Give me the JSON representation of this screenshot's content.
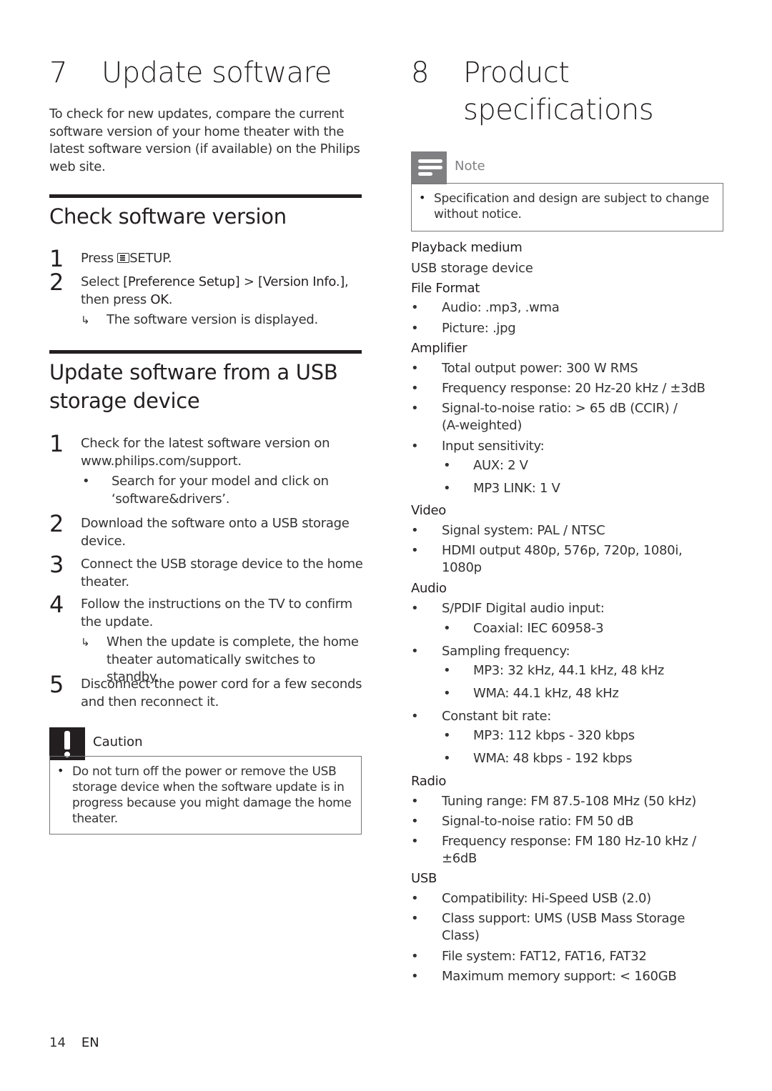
{
  "left": {
    "chapter_number": "7",
    "chapter_title": "Update software",
    "intro": "To check for new updates, compare the current software version of your home theater with the latest software version (if available) on the Philips web site.",
    "section1": {
      "title": "Check software version",
      "steps": [
        {
          "n": "1",
          "pre": "Press ",
          "icon": "setup-icon",
          "post": "SETUP."
        },
        {
          "n": "2",
          "text_a": "Select ",
          "bold_a": "[Preference Setup]",
          "text_b": " > ",
          "bold_b": "[Version Info.]",
          "text_c": ", then press ",
          "bold_c": "OK",
          "text_d": "."
        }
      ],
      "result": "The software version is displayed."
    },
    "section2": {
      "title_line1": "Update software from a USB",
      "title_line2": "storage device",
      "steps": [
        {
          "n": "1",
          "text": "Check for the latest software version on www.philips.com/support."
        },
        {
          "n": "2",
          "text": "Download the software onto a USB storage device."
        },
        {
          "n": "3",
          "text": "Connect the USB storage device to the home theater."
        },
        {
          "n": "4",
          "text": "Follow the instructions on the TV to confirm the update."
        },
        {
          "n": "5",
          "text": "Disconnect the power cord for a few seconds and then reconnect it."
        }
      ],
      "sub_bullet": "Search for your model and click on ‘software&drivers’.",
      "result": "When the update is complete, the home theater automatically switches to standby."
    },
    "caution": {
      "label": "Caution",
      "text": "Do not turn off the power or remove the USB storage device when the software update is in progress because you might damage the home theater."
    }
  },
  "right": {
    "chapter_number": "8",
    "chapter_title_line1": "Product",
    "chapter_title_line2": "specifications",
    "note": {
      "label": "Note",
      "text": "Specification and design are subject to change without notice."
    },
    "specs": {
      "playback_medium": {
        "heading": "Playback medium",
        "value": "USB storage device"
      },
      "file_format": {
        "heading": "File Format",
        "items": [
          "Audio: .mp3, .wma",
          "Picture: .jpg"
        ]
      },
      "amplifier": {
        "heading": "Amplifier",
        "items": [
          "Total output power: 300 W RMS",
          "Frequency response: 20 Hz-20 kHz / ±3dB",
          "Signal-to-noise ratio: > 65 dB (CCIR) / (A-weighted)",
          "Input sensitivity:"
        ],
        "sub_items": [
          "AUX: 2 V",
          "MP3 LINK: 1 V"
        ]
      },
      "video": {
        "heading": "Video",
        "items": [
          "Signal system: PAL / NTSC",
          "HDMI output 480p, 576p, 720p, 1080i, 1080p"
        ]
      },
      "audio": {
        "heading": "Audio",
        "items": [
          "S/PDIF Digital audio input:",
          "Sampling frequency:",
          "Constant bit rate:"
        ],
        "spdif_sub": [
          "Coaxial: IEC 60958-3"
        ],
        "sampling_sub": [
          "MP3: 32 kHz, 44.1 kHz, 48 kHz",
          "WMA: 44.1 kHz, 48 kHz"
        ],
        "bitrate_sub": [
          "MP3: 112 kbps - 320 kbps",
          "WMA: 48 kbps - 192 kbps"
        ]
      },
      "radio": {
        "heading": "Radio",
        "items": [
          "Tuning range: FM 87.5-108 MHz (50 kHz)",
          "Signal-to-noise ratio: FM 50 dB",
          "Frequency response: FM 180 Hz-10 kHz / ±6dB"
        ]
      },
      "usb": {
        "heading": "USB",
        "items": [
          "Compatibility: Hi-Speed USB (2.0)",
          "Class support: UMS (USB Mass Storage Class)",
          "File system: FAT12, FAT16, FAT32",
          "Maximum memory support: < 160GB"
        ]
      }
    }
  },
  "footer": {
    "page_number": "14",
    "language": "EN"
  },
  "bullet": "•",
  "arrow": "↳"
}
